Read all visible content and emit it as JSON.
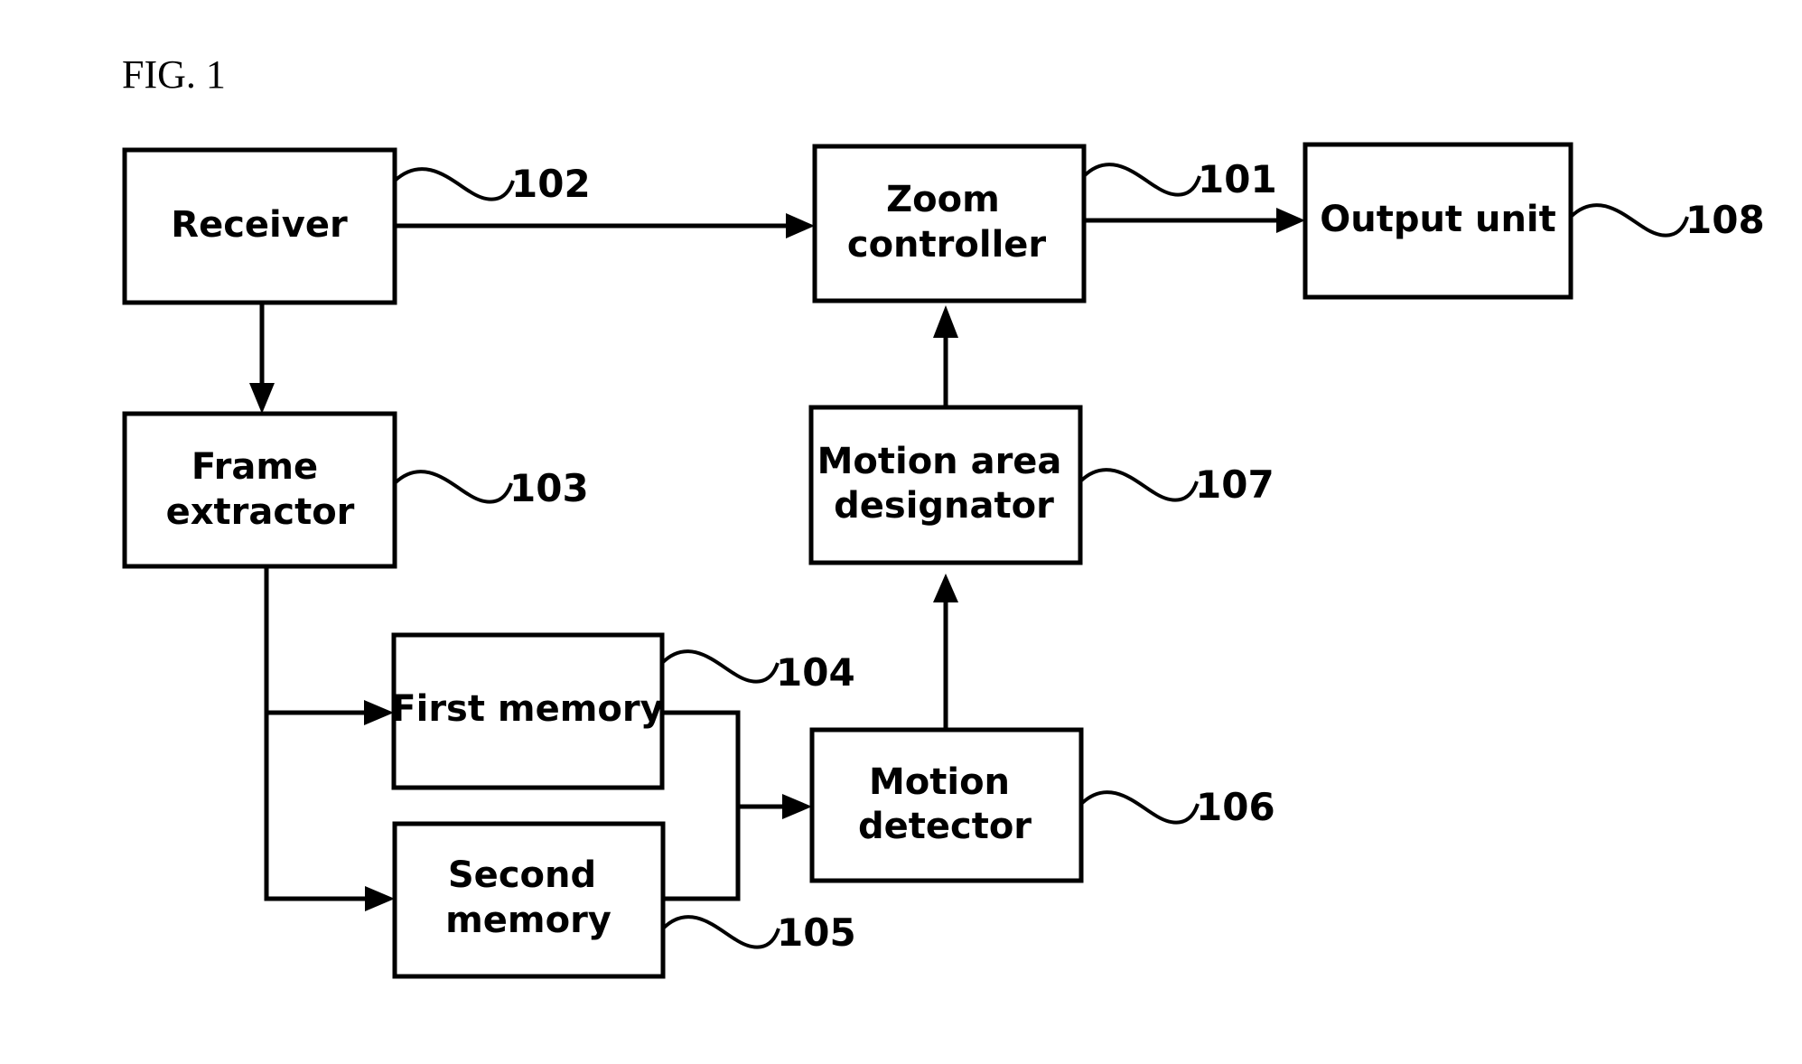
{
  "figure": {
    "title": "FIG. 1"
  },
  "blocks": {
    "receiver": {
      "lines": [
        "Receiver"
      ],
      "ref": "102"
    },
    "zoom_controller": {
      "lines": [
        "Zoom",
        "controller"
      ],
      "ref": "101"
    },
    "output_unit": {
      "lines": [
        "Output unit"
      ],
      "ref": "108"
    },
    "frame_extractor": {
      "lines": [
        "Frame",
        "extractor"
      ],
      "ref": "103"
    },
    "motion_area_designator": {
      "lines": [
        "Motion area",
        "designator"
      ],
      "ref": "107"
    },
    "first_memory": {
      "lines": [
        "First memory"
      ],
      "ref": "104"
    },
    "second_memory": {
      "lines": [
        "Second",
        "memory"
      ],
      "ref": "105"
    },
    "motion_detector": {
      "lines": [
        "Motion",
        "detector"
      ],
      "ref": "106"
    }
  },
  "connections": [
    {
      "from": "receiver",
      "to": "zoom_controller"
    },
    {
      "from": "receiver",
      "to": "frame_extractor"
    },
    {
      "from": "zoom_controller",
      "to": "output_unit"
    },
    {
      "from": "frame_extractor",
      "to": "first_memory"
    },
    {
      "from": "frame_extractor",
      "to": "second_memory"
    },
    {
      "from": "first_memory",
      "to": "motion_detector"
    },
    {
      "from": "second_memory",
      "to": "motion_detector"
    },
    {
      "from": "motion_detector",
      "to": "motion_area_designator"
    },
    {
      "from": "motion_area_designator",
      "to": "zoom_controller"
    }
  ]
}
